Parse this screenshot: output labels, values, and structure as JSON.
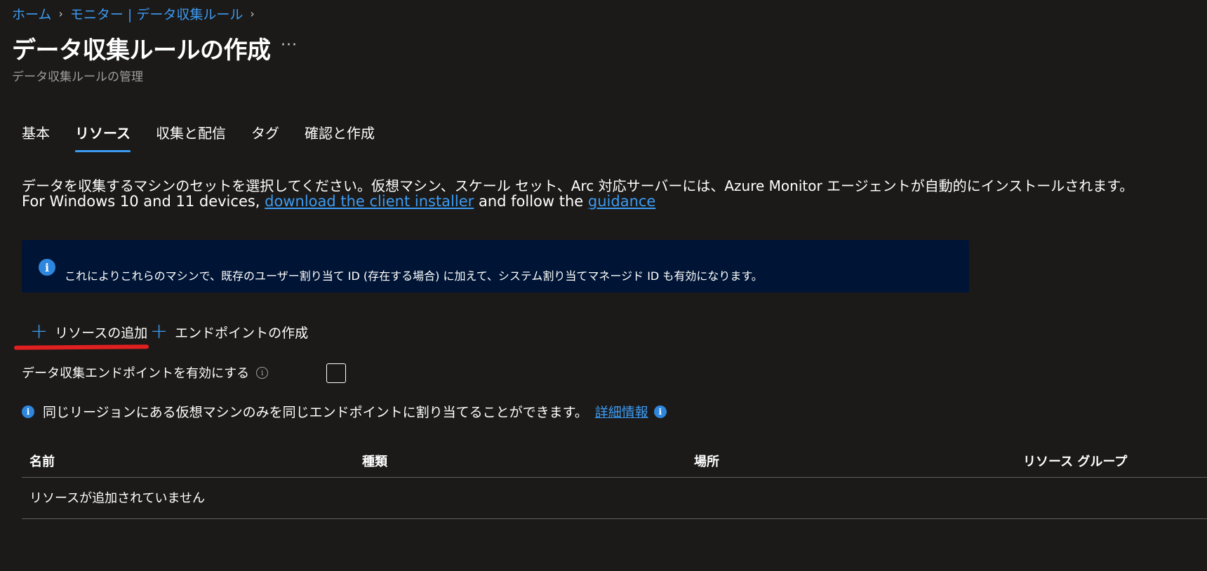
{
  "breadcrumb": {
    "home": "ホーム",
    "monitor": "モニター | データ収集ルール"
  },
  "header": {
    "title": "データ収集ルールの作成",
    "more": "···",
    "subtitle": "データ収集ルールの管理"
  },
  "tabs": [
    {
      "label": "基本",
      "active": false
    },
    {
      "label": "リソース",
      "active": true
    },
    {
      "label": "収集と配信",
      "active": false
    },
    {
      "label": "タグ",
      "active": false
    },
    {
      "label": "確認と作成",
      "active": false
    }
  ],
  "description": {
    "line1": "データを収集するマシンのセットを選択してください。仮想マシン、スケール セット、Arc 対応サーバーには、Azure Monitor エージェントが自動的にインストールされます。",
    "line2_prefix": "For Windows 10 and 11 devices, ",
    "line2_link1": "download the client installer",
    "line2_middle": " and follow the ",
    "line2_link2": "guidance"
  },
  "info_banner": {
    "text": "これによりこれらのマシンで、既存のユーザー割り当て ID (存在する場合) に加えて、システム割り当てマネージド ID も有効になります。"
  },
  "actions": {
    "add_resource": "リソースの追加",
    "create_endpoint": "エンドポイントの作成"
  },
  "endpoint_option": {
    "label": "データ収集エンドポイントを有効にする",
    "checked": false
  },
  "region_note": {
    "text": "同じリージョンにある仮想マシンのみを同じエンドポイントに割り当てることができます。",
    "link": "詳細情報"
  },
  "table": {
    "columns": [
      "名前",
      "種類",
      "場所",
      "リソース グループ"
    ],
    "empty_message": "リソースが追加されていません"
  },
  "colors": {
    "background": "#1b1a19",
    "accent": "#3d9bf2",
    "banner_bg": "#001535",
    "highlight": "#e02020"
  },
  "icons": {
    "info": "info-icon",
    "plus": "plus-icon",
    "chevron": "chevron-right-icon"
  }
}
